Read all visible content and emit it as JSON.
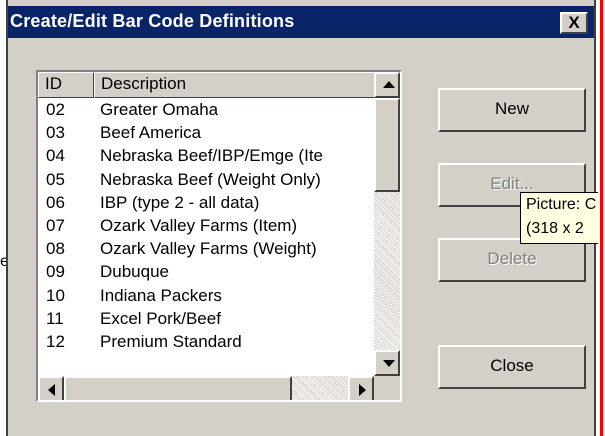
{
  "window": {
    "title": "Create/Edit Bar Code Definitions",
    "close_glyph": "X"
  },
  "stray_text": "e",
  "list": {
    "columns": [
      "ID",
      "Description"
    ],
    "rows": [
      {
        "id": "02",
        "description": "Greater Omaha"
      },
      {
        "id": "03",
        "description": "Beef America"
      },
      {
        "id": "04",
        "description": "Nebraska Beef/IBP/Emge (Ite"
      },
      {
        "id": "05",
        "description": "Nebraska Beef (Weight Only)"
      },
      {
        "id": "06",
        "description": "IBP (type 2 - all data)"
      },
      {
        "id": "07",
        "description": "Ozark Valley Farms (Item)"
      },
      {
        "id": "08",
        "description": "Ozark Valley Farms (Weight)"
      },
      {
        "id": "09",
        "description": "Dubuque"
      },
      {
        "id": "10",
        "description": "Indiana Packers"
      },
      {
        "id": "11",
        "description": "Excel Pork/Beef"
      },
      {
        "id": "12",
        "description": "Premium Standard"
      }
    ]
  },
  "buttons": {
    "new": "New",
    "edit": "Edit...",
    "delete": "Delete",
    "close": "Close"
  },
  "tooltip": {
    "line1": "Picture: C",
    "line2": "(318 x 2"
  },
  "colors": {
    "titlebar": "#0a246a",
    "dialog_face": "#d4d0c8",
    "tooltip_bg": "#ffffe1",
    "edge_line": "#ff0000"
  }
}
